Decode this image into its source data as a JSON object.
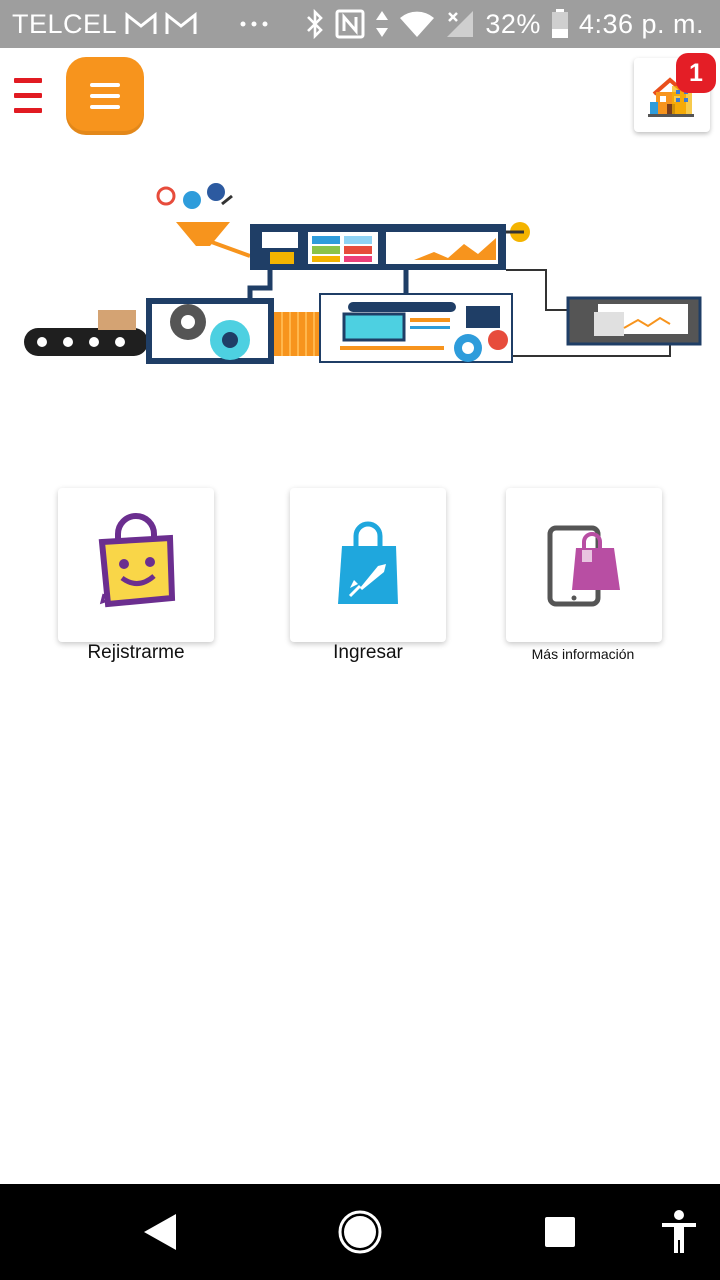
{
  "status_bar": {
    "carrier": "TELCEL",
    "battery": "32%",
    "time": "4:36 p. m."
  },
  "header": {
    "notification_count": "1"
  },
  "tiles": [
    {
      "label": "Rejistrarme"
    },
    {
      "label": "Ingresar"
    },
    {
      "label": "Más información"
    }
  ],
  "colors": {
    "menu_red": "#e11b22",
    "logo_orange": "#f7941d",
    "badge_red": "#e41e26",
    "register_purple": "#6b2e8f",
    "register_yellow": "#f9d648",
    "login_blue": "#1fa7dd",
    "info_pink": "#b84ea3"
  },
  "icons": [
    "menu-icon",
    "app-logo-menu-icon",
    "notification-house-icon",
    "register-bag-icon",
    "login-rocket-bag-icon",
    "info-phone-bag-icon",
    "back-icon",
    "home-icon",
    "recents-icon",
    "accessibility-icon"
  ]
}
